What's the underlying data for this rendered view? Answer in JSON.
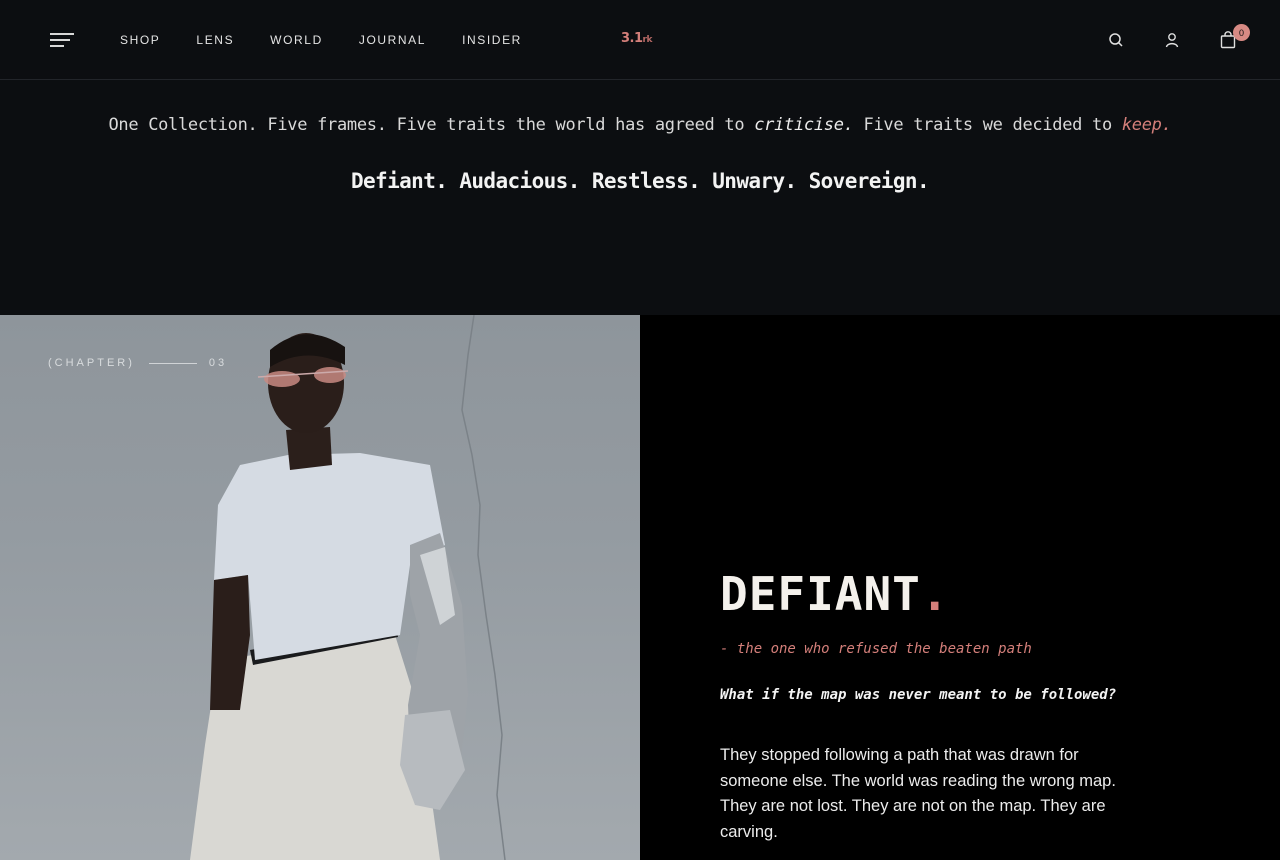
{
  "nav": {
    "items": [
      "SHOP",
      "LENS",
      "WORLD",
      "JOURNAL",
      "INSIDER"
    ],
    "logo_main": "3.1",
    "logo_suffix": "rk",
    "cart_count": "0"
  },
  "intro": {
    "line_part1": "One Collection. Five frames. Five traits the world has agreed to ",
    "line_em1": "criticise.",
    "line_part2": " Five traits we decided to ",
    "line_em2": "keep.",
    "traits": "Defiant. Audacious. Restless. Unwary. Sovereign."
  },
  "chapter": {
    "label": "(CHAPTER)",
    "number": "03"
  },
  "trait": {
    "title": "DEFIANT",
    "title_dot": ".",
    "tagline": "- the one who refused the beaten path",
    "question": "What if the map was never meant to be followed?",
    "body": "They stopped following a path that was drawn for someone else. The world was reading the wrong map. They are not lost. They are not on the map. They are carving."
  },
  "colors": {
    "accent": "#d47f7a",
    "background": "#0c0e11",
    "panel": "#000000"
  }
}
